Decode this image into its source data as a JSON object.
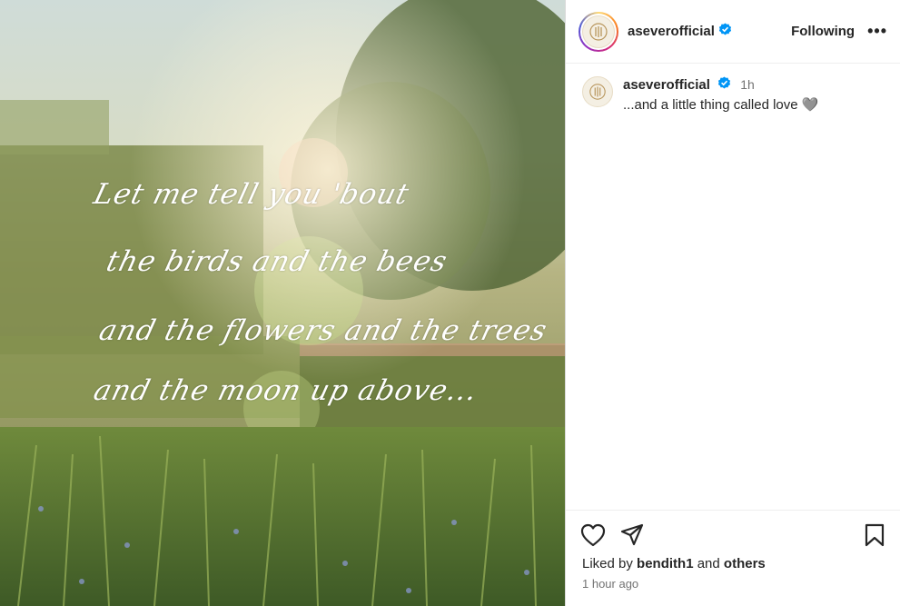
{
  "post": {
    "media": {
      "script_lines": [
        "Let me tell you 'bout",
        "the birds and the bees",
        "and the flowers and the trees",
        "and the moon up above..."
      ]
    },
    "header": {
      "username": "aseverofficial",
      "verified": true,
      "follow_label": "Following",
      "more_label": "•••"
    },
    "caption": {
      "username": "aseverofficial",
      "time": "1h",
      "text": "...and a little thing called love",
      "emoji": "🩶"
    },
    "likes": {
      "prefix": "Liked by",
      "user": "bendith1",
      "and": "and",
      "others": "others"
    },
    "posted_ago": "1 hour ago",
    "colors": {
      "verified": "#0095f6",
      "text": "#262626",
      "muted": "#737373"
    },
    "icons": [
      "heart-icon",
      "share-icon",
      "bookmark-icon",
      "verified-badge-icon",
      "more-icon"
    ]
  }
}
